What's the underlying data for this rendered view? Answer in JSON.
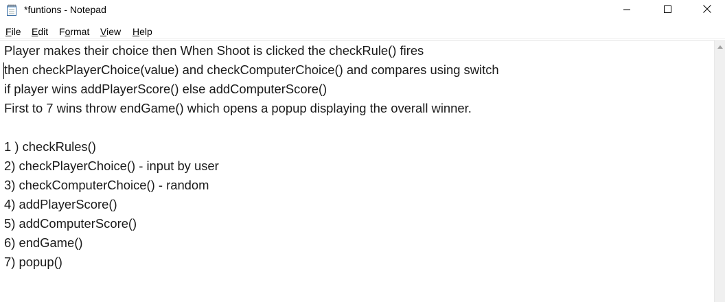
{
  "window": {
    "title": "*funtions - Notepad",
    "app_icon": "notepad-icon",
    "buttons": {
      "minimize_icon": "minimize-icon",
      "maximize_icon": "maximize-icon",
      "close_icon": "close-icon"
    }
  },
  "menu": {
    "items": [
      {
        "name": "file",
        "underline": "F",
        "rest": "ile"
      },
      {
        "name": "edit",
        "underline": "E",
        "rest": "dit"
      },
      {
        "name": "format",
        "pre": "F",
        "underline": "o",
        "rest": "rmat"
      },
      {
        "name": "view",
        "underline": "V",
        "rest": "iew"
      },
      {
        "name": "help",
        "underline": "H",
        "rest": "elp"
      }
    ]
  },
  "editor": {
    "lines": [
      "Player makes their choice then When Shoot is clicked the checkRule() fires",
      "then checkPlayerChoice(value) and checkComputerChoice() and compares using switch",
      "if player wins addPlayerScore() else addComputerScore()",
      "First to 7 wins throw endGame() which opens a popup displaying the overall winner.",
      "",
      "1 ) checkRules()",
      "2) checkPlayerChoice() - input by user",
      "3) checkComputerChoice() - random",
      "4) addPlayerScore()",
      "5) addComputerScore()",
      "6) endGame()",
      "7) popup()"
    ]
  },
  "scrollbar": {
    "up_icon": "scroll-up-arrow-icon"
  }
}
